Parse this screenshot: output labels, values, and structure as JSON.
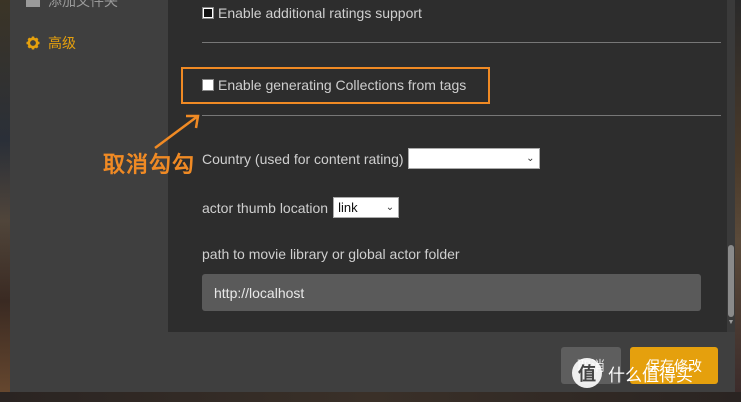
{
  "sidebar": {
    "items": [
      {
        "label": "添加文件夹",
        "icon": "folder-icon"
      },
      {
        "label": "高级",
        "icon": "gear-icon"
      }
    ]
  },
  "settings": {
    "additional_ratings": {
      "label": "Enable additional ratings support",
      "checked": true
    },
    "collections_from_tags": {
      "label": "Enable generating Collections from tags",
      "checked": false
    },
    "country": {
      "label": "Country (used for content rating)",
      "value": ""
    },
    "actor_thumb": {
      "label": "actor thumb location",
      "value": "link"
    },
    "path": {
      "label": "path to movie library or global actor folder",
      "value": "http://localhost"
    }
  },
  "footer": {
    "cancel_label": "取消",
    "save_label": "保存修改"
  },
  "annotation": {
    "text": "取消勾勾",
    "color": "#f08a24"
  },
  "watermark": {
    "text": "什么值得买",
    "logo": "值"
  },
  "colors": {
    "accent": "#e5a00d",
    "highlight": "#f08a24"
  }
}
